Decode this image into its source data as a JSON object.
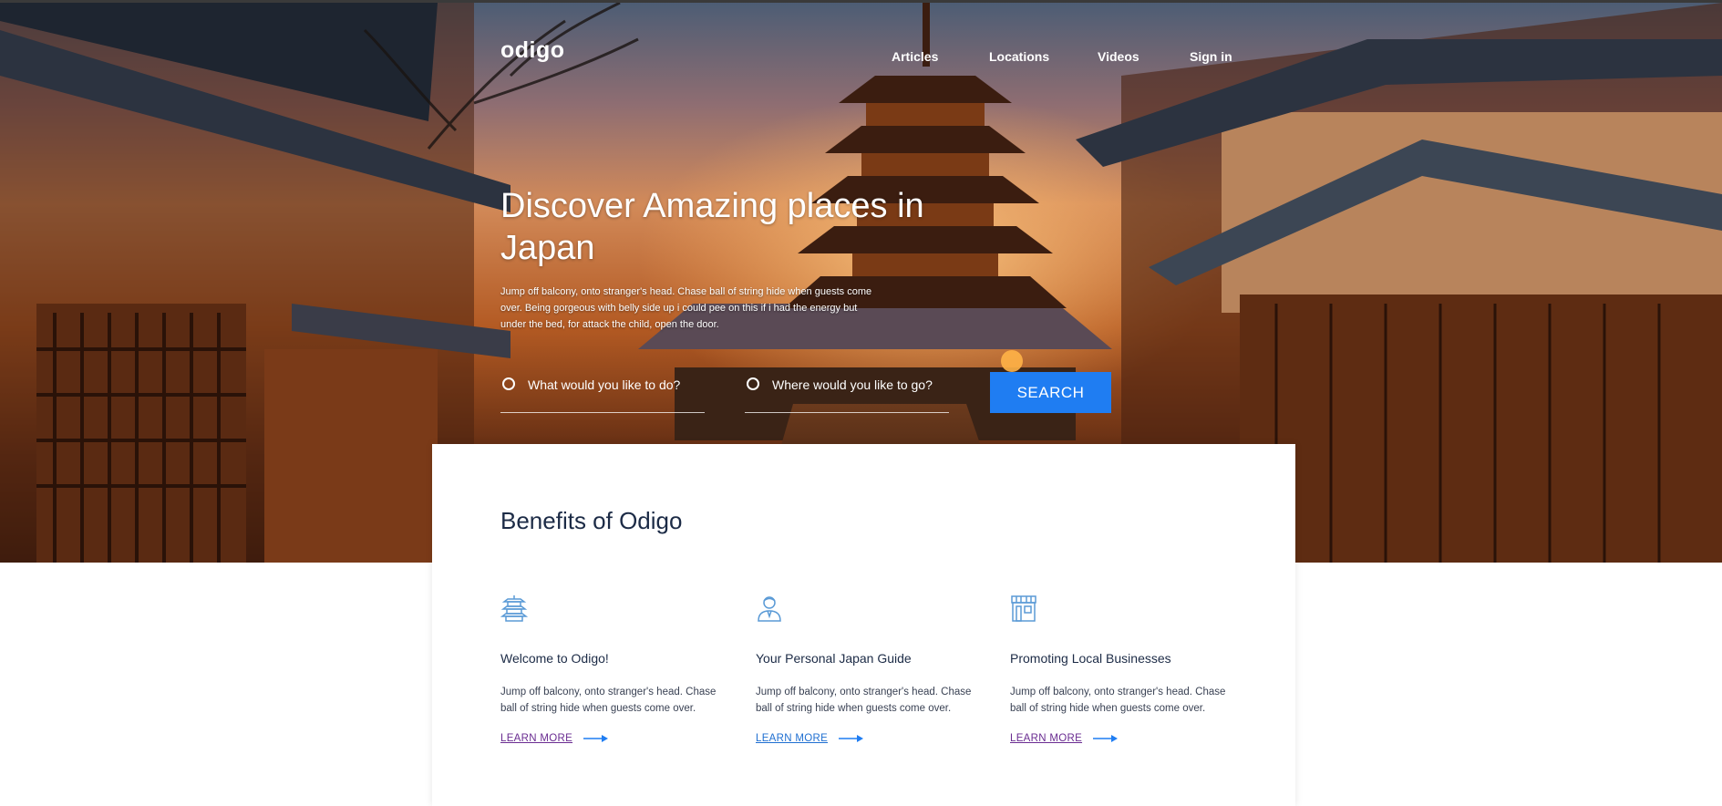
{
  "brand": {
    "logo": "odigo"
  },
  "nav": {
    "articles": "Articles",
    "locations": "Locations",
    "videos": "Videos",
    "signin": "Sign in"
  },
  "hero": {
    "title": "Discover Amazing places in Japan",
    "subtitle": "Jump off balcony, onto stranger's head. Chase ball of string hide when guests come over. Being gorgeous with belly side up i could pee on this if i had the energy but under the bed, for attack the child, open the door."
  },
  "search": {
    "what_placeholder": "What would you like to do?",
    "where_placeholder": "Where would you like to go?",
    "button_label": "SEARCH"
  },
  "benefits": {
    "title": "Benefits of Odigo",
    "items": [
      {
        "icon": "pagoda-icon",
        "title": "Welcome to Odigo!",
        "text": "Jump off balcony, onto stranger's head. Chase ball of string hide when guests come over.",
        "link": "LEARN MORE"
      },
      {
        "icon": "guide-person-icon",
        "title": "Your Personal Japan Guide",
        "text": "Jump off balcony, onto stranger's head. Chase ball of string hide when guests come over.",
        "link": "LEARN MORE"
      },
      {
        "icon": "storefront-icon",
        "title": "Promoting Local Businesses",
        "text": "Jump off balcony, onto stranger's head. Chase ball of string hide when guests come over.",
        "link": "LEARN MORE"
      }
    ]
  },
  "colors": {
    "accent": "#1f7df2",
    "heading": "#1c2b46",
    "link_visited": "#6a2c91",
    "link": "#1f6fd1",
    "icon": "#5a9ad6"
  }
}
